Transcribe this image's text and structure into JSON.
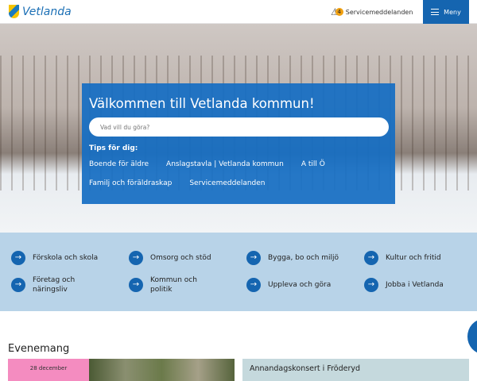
{
  "header": {
    "logo": "Vetlanda",
    "service_count": "4",
    "service_label": "Servicemeddelanden",
    "menu_label": "Meny"
  },
  "hero": {
    "title": "Välkommen till Vetlanda kommun!",
    "search_placeholder": "Vad vill du göra?",
    "tips_heading": "Tips för dig:",
    "tips": [
      "Boende för äldre",
      "Anslagstavla | Vetlanda kommun",
      "A till Ö",
      "Familj och föräldraskap",
      "Servicemeddelanden"
    ]
  },
  "quick_links": [
    "Förskola och skola",
    "Omsorg och stöd",
    "Bygga, bo och miljö",
    "Kultur och fritid",
    "Företag och näringsliv",
    "Kommun och politik",
    "Uppleva och göra",
    "Jobba i Vetlanda"
  ],
  "events": {
    "heading": "Evenemang",
    "date": "28 december",
    "title": "Annandagskonsert i Fröderyd"
  }
}
